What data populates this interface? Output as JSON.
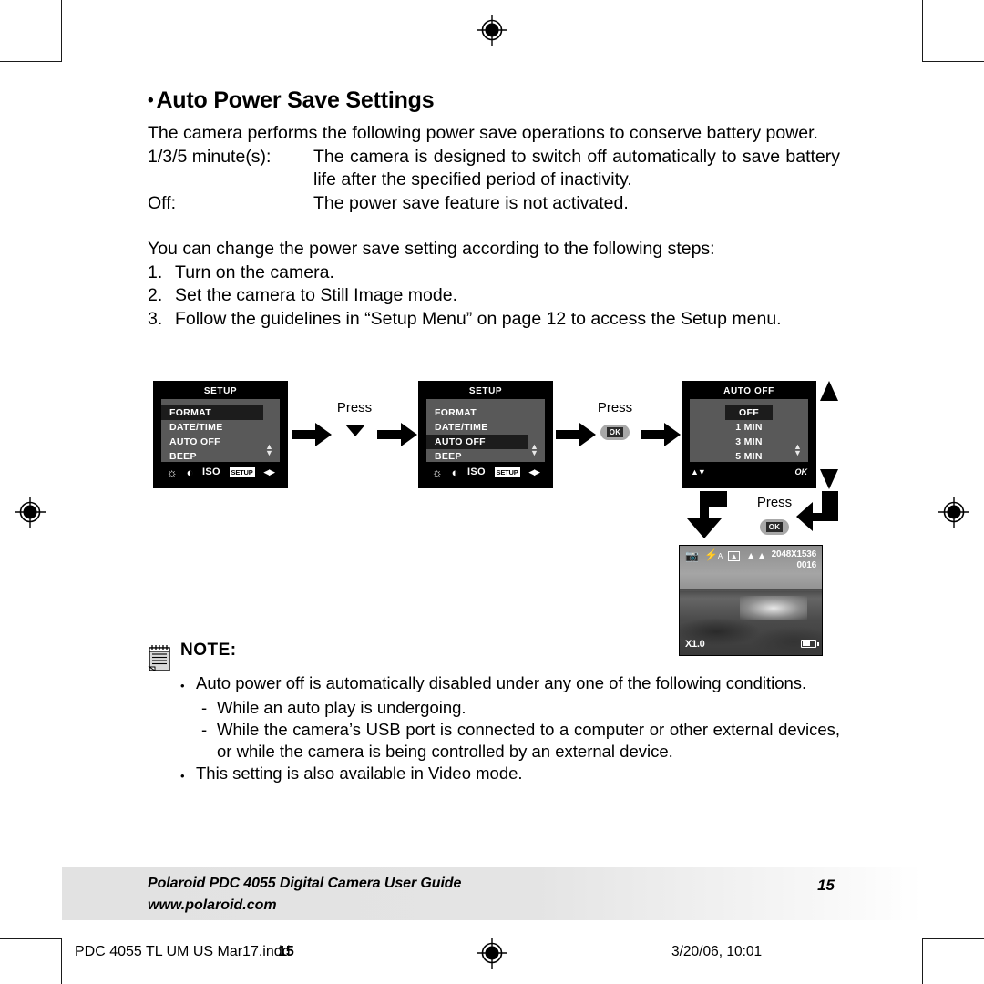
{
  "section": {
    "bullet": "•",
    "title": "Auto Power Save Settings",
    "intro": "The camera performs the following power save operations to conserve battery power.",
    "definitions": [
      {
        "term": "1/3/5 minute(s):",
        "desc": "The camera is designed to switch off automatically to save battery life after the specified period of inactivity."
      },
      {
        "term": "Off:",
        "desc": "The power save feature is not activated."
      }
    ],
    "steps_intro": "You can change the power save setting according to the following steps:",
    "steps": [
      {
        "num": "1.",
        "text": "Turn on the camera."
      },
      {
        "num": "2.",
        "text": "Set the camera to Still Image mode."
      },
      {
        "num": "3.",
        "text": "Follow the guidelines in “Setup Menu” on page 12 to access the Setup menu."
      }
    ]
  },
  "diagram": {
    "screen1": {
      "title": "SETUP",
      "items": [
        "FORMAT",
        "DATE/TIME",
        "AUTO OFF",
        "BEEP"
      ],
      "selected": "FORMAT",
      "bottom_icons": [
        "brightness-icon",
        "contrast-icon",
        "ISO",
        "SETUP",
        "left-right-icon"
      ],
      "iso_label": "ISO",
      "setup_tag": "SETUP",
      "scroll_up": "▲",
      "scroll_down": "▼"
    },
    "screen2": {
      "title": "SETUP",
      "items": [
        "FORMAT",
        "DATE/TIME",
        "AUTO OFF",
        "BEEP"
      ],
      "selected": "AUTO OFF",
      "iso_label": "ISO",
      "setup_tag": "SETUP"
    },
    "screen3": {
      "title": "AUTO OFF",
      "items": [
        "OFF",
        "1 MIN",
        "3 MIN",
        "5 MIN"
      ],
      "selected": "OFF",
      "bottom_left": "▲▼",
      "bottom_right": "OK"
    },
    "press_1": {
      "label": "Press",
      "control": "down-arrow"
    },
    "press_2": {
      "label": "Press",
      "control": "OK"
    },
    "press_3": {
      "label": "Press",
      "control": "OK"
    },
    "ok_label": "OK"
  },
  "preview": {
    "resolution": "2048X1536",
    "count": "0016",
    "zoom": "X1.0",
    "flash": "A",
    "icons": [
      "camera-icon",
      "flash-auto-icon",
      "portrait-frame-icon",
      "landscape-icon",
      "battery-icon"
    ]
  },
  "note": {
    "title": "NOTE:",
    "items": [
      {
        "marker": "•",
        "text": "Auto power off is automatically disabled under any one of the following conditions.",
        "sub": false
      },
      {
        "marker": "-",
        "text": "While an auto play is undergoing.",
        "sub": true
      },
      {
        "marker": "-",
        "text": "While the camera’s USB port is connected to a computer or other external devices, or while the camera is being controlled by an external device.",
        "sub": true
      },
      {
        "marker": "•",
        "text": "This setting is also available in Video mode.",
        "sub": false
      }
    ]
  },
  "footer": {
    "line1": "Polaroid PDC 4055 Digital Camera User Guide",
    "line2": "www.polaroid.com",
    "page": "15"
  },
  "bleed": {
    "filename": "PDC 4055 TL UM US Mar17.indd",
    "page": "15",
    "timestamp": "3/20/06, 10:01"
  }
}
